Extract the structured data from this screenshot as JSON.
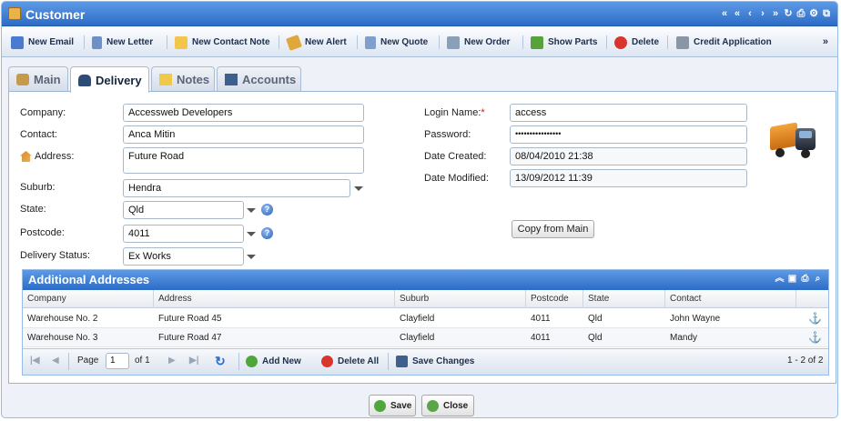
{
  "window": {
    "title": "Customer",
    "title_tools": [
      "«",
      "«",
      "‹",
      "›",
      "»",
      "↻",
      "⎙",
      "⚙",
      "⧉"
    ]
  },
  "toolbar": {
    "items": [
      {
        "label": "New Email",
        "icon": "email-icon",
        "color": "#4a7bd0"
      },
      {
        "label": "New Letter",
        "icon": "letter-icon",
        "color": "#6f8fc8"
      },
      {
        "label": "New Contact Note",
        "icon": "note-icon",
        "color": "#f3c54a"
      },
      {
        "label": "New Alert",
        "icon": "alert-icon",
        "color": "#e0a83a"
      },
      {
        "label": "New Quote",
        "icon": "quote-icon",
        "color": "#7fa0cf"
      },
      {
        "label": "New Order",
        "icon": "order-icon",
        "color": "#8aa0b8"
      },
      {
        "label": "Show Parts",
        "icon": "parts-icon",
        "color": "#57a23b"
      },
      {
        "label": "Delete",
        "icon": "delete-icon",
        "color": "#d9352c"
      },
      {
        "label": "Credit Application",
        "icon": "print-icon",
        "color": "#8a95a5"
      }
    ],
    "more": "»"
  },
  "tabs": [
    {
      "label": "Main",
      "active": false
    },
    {
      "label": "Delivery",
      "active": true
    },
    {
      "label": "Notes",
      "active": false
    },
    {
      "label": "Accounts",
      "active": false
    }
  ],
  "form": {
    "company_label": "Company:",
    "company": "Accessweb Developers",
    "contact_label": "Contact:",
    "contact": "Anca Mitin",
    "address_label": "Address:",
    "address": "Future Road",
    "suburb_label": "Suburb:",
    "suburb": "Hendra",
    "state_label": "State:",
    "state": "Qld",
    "postcode_label": "Postcode:",
    "postcode": "4011",
    "delivery_status_label": "Delivery Status:",
    "delivery_status": "Ex Works",
    "login_label": "Login Name:",
    "login_required": "*",
    "login": "access",
    "password_label": "Password:",
    "password": "••••••••••••••••",
    "created_label": "Date Created:",
    "created": "08/04/2010 21:38",
    "modified_label": "Date Modified:",
    "modified": "13/09/2012 11:39",
    "copy_button": "Copy from Main"
  },
  "addresses": {
    "title": "Additional Addresses",
    "columns": [
      "Company",
      "Address",
      "Suburb",
      "Postcode",
      "State",
      "Contact"
    ],
    "rows": [
      [
        "Warehouse No. 2",
        "Future Road 45",
        "Clayfield",
        "4011",
        "Qld",
        "John Wayne"
      ],
      [
        "Warehouse No. 3",
        "Future Road 47",
        "Clayfield",
        "4011",
        "Qld",
        "Mandy"
      ]
    ],
    "paging": {
      "page_label": "Page",
      "page": "1",
      "of_label": "of 1",
      "add_new": "Add New",
      "delete_all": "Delete All",
      "save_changes": "Save Changes",
      "summary": "1 - 2 of 2"
    }
  },
  "buttons": {
    "save": "Save",
    "close": "Close"
  },
  "colors": {
    "accent": "#2d6cc7",
    "required": "#d01818"
  }
}
